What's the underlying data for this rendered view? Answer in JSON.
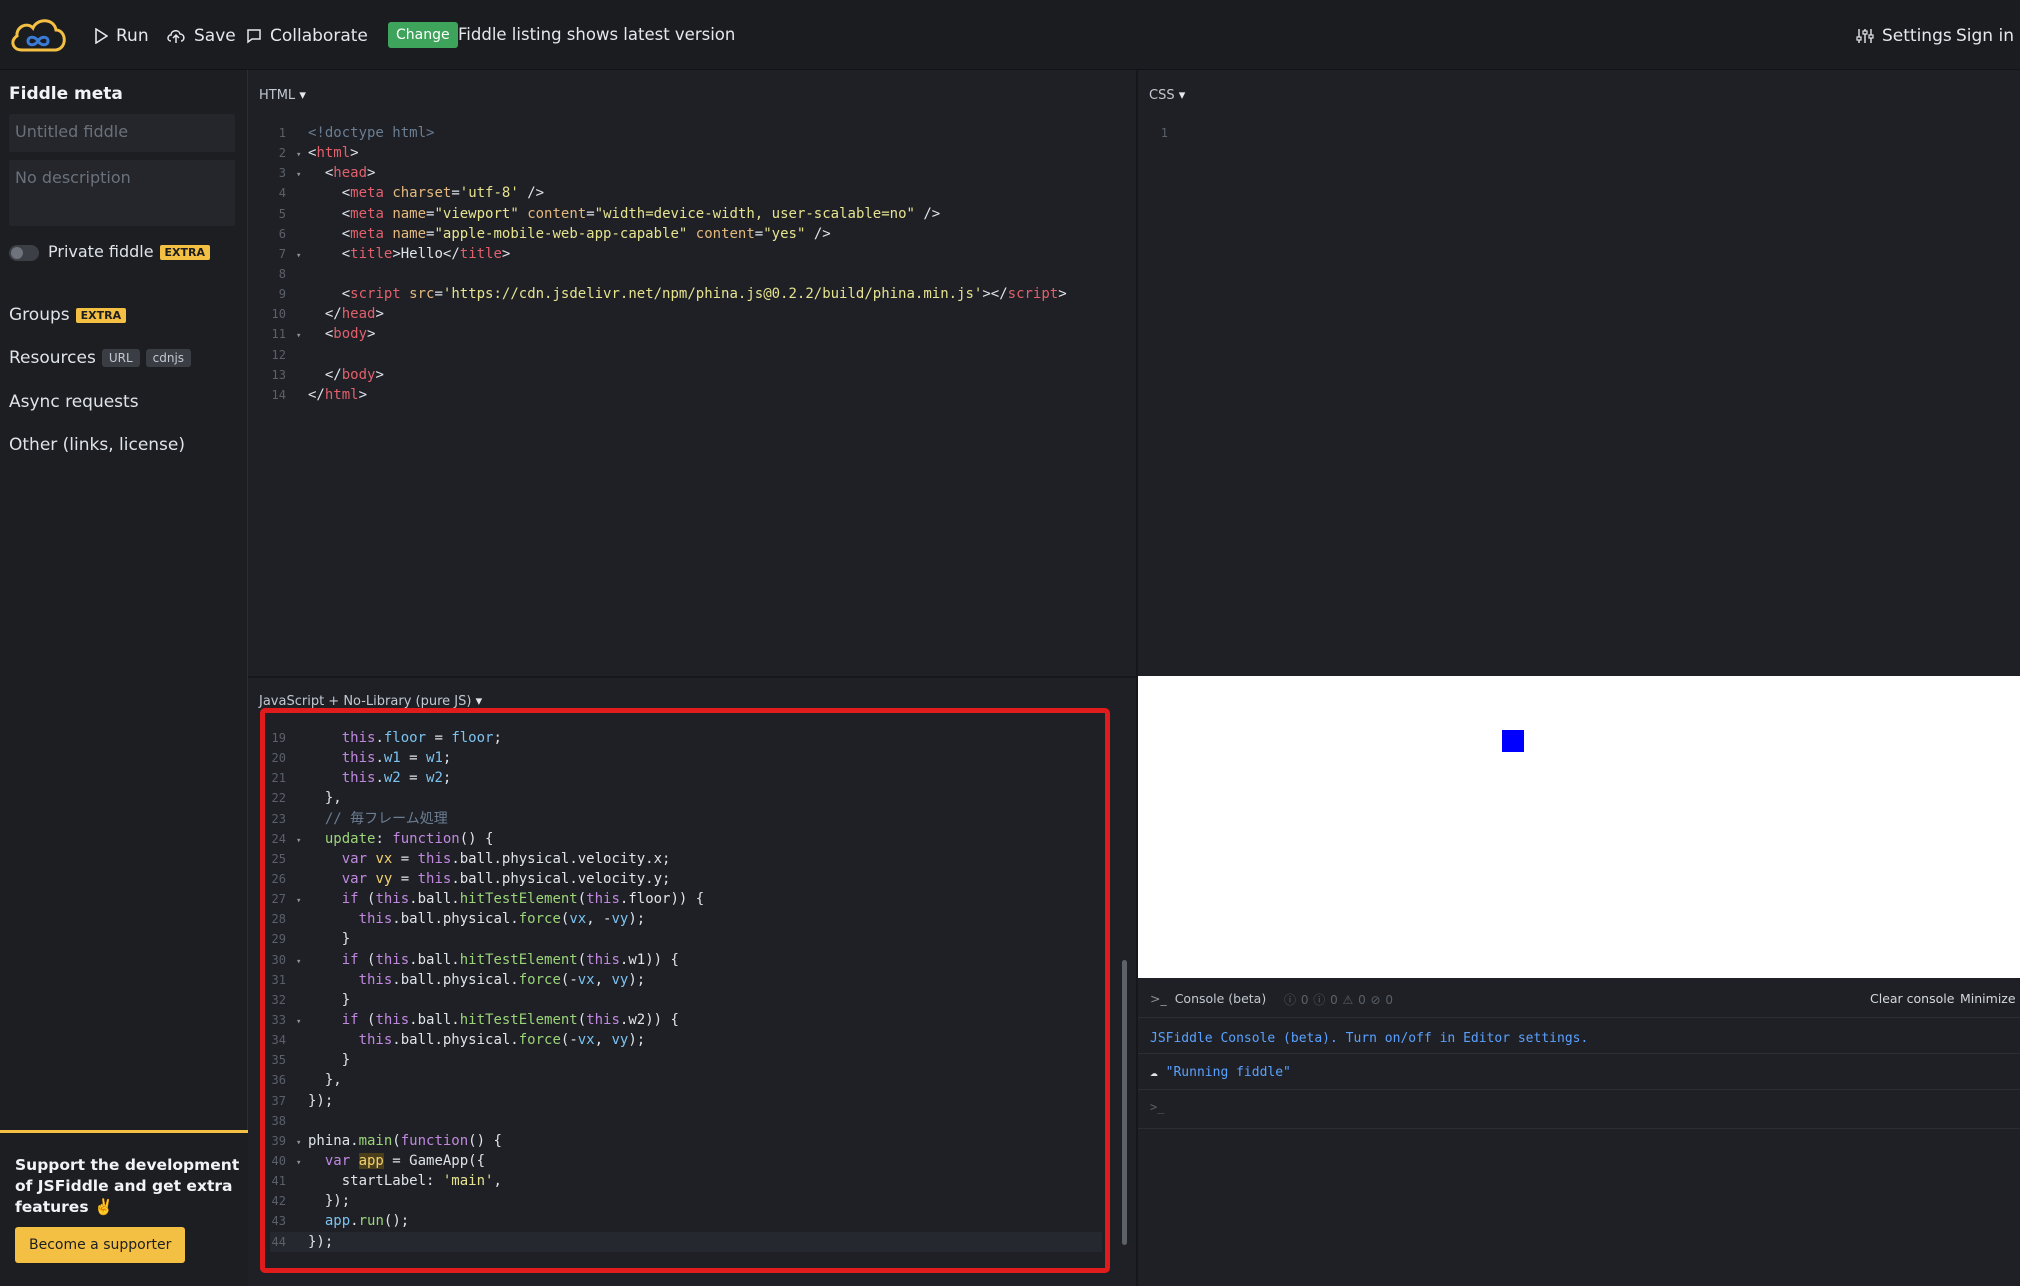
{
  "topbar": {
    "run_label": "Run",
    "save_label": "Save",
    "collaborate_label": "Collaborate",
    "change_badge": "Change",
    "notice": "Fiddle listing shows latest version",
    "settings_label": "Settings",
    "signin_label": "Sign in"
  },
  "sidebar": {
    "title": "Fiddle meta",
    "title_placeholder": "Untitled fiddle",
    "description_placeholder": "No description",
    "private_label": "Private fiddle",
    "extra_tag": "EXTRA",
    "groups_label": "Groups",
    "resources_label": "Resources",
    "url_tag": "URL",
    "cdnjs_tag": "cdnjs",
    "async_label": "Async requests",
    "other_label": "Other (links, license)",
    "support_text": "Support the development of JSFiddle and get extra features ✌️",
    "support_button": "Become a supporter"
  },
  "panels": {
    "html_label": "HTML",
    "css_label": "CSS",
    "js_label": "JavaScript + No-Library (pure JS)"
  },
  "html_code": {
    "l1": "<!doctype html>",
    "l9_src": "'https://cdn.jsdelivr.net/npm/phina.js@0.2.2/build/phina.min.js'",
    "l7_text": "Hello",
    "l4_charset": "'utf-8'",
    "l5_name": "\"viewport\"",
    "l5_content": "\"width=device-width, user-scalable=no\"",
    "l6_name": "\"apple-mobile-web-app-capable\"",
    "l6_content": "\"yes\""
  },
  "js_code": {
    "comment": "// 毎フレーム処理",
    "start_label": "'main'"
  },
  "console": {
    "title": "Console (beta)",
    "counts": "ⓘ 0  ⓘ 0  ⚠ 0  ⊘ 0",
    "clear_label": "Clear console",
    "minimize_label": "Minimize",
    "info_line": "JSFiddle Console (beta). Turn on/off in Editor settings.",
    "log_line": "\"Running fiddle\"",
    "prompt": ">_"
  },
  "colors": {
    "accent_yellow": "#f4c043",
    "change_green": "#3fa45b",
    "highlight_red": "#e01b1b",
    "ball_blue": "#0000ff"
  }
}
